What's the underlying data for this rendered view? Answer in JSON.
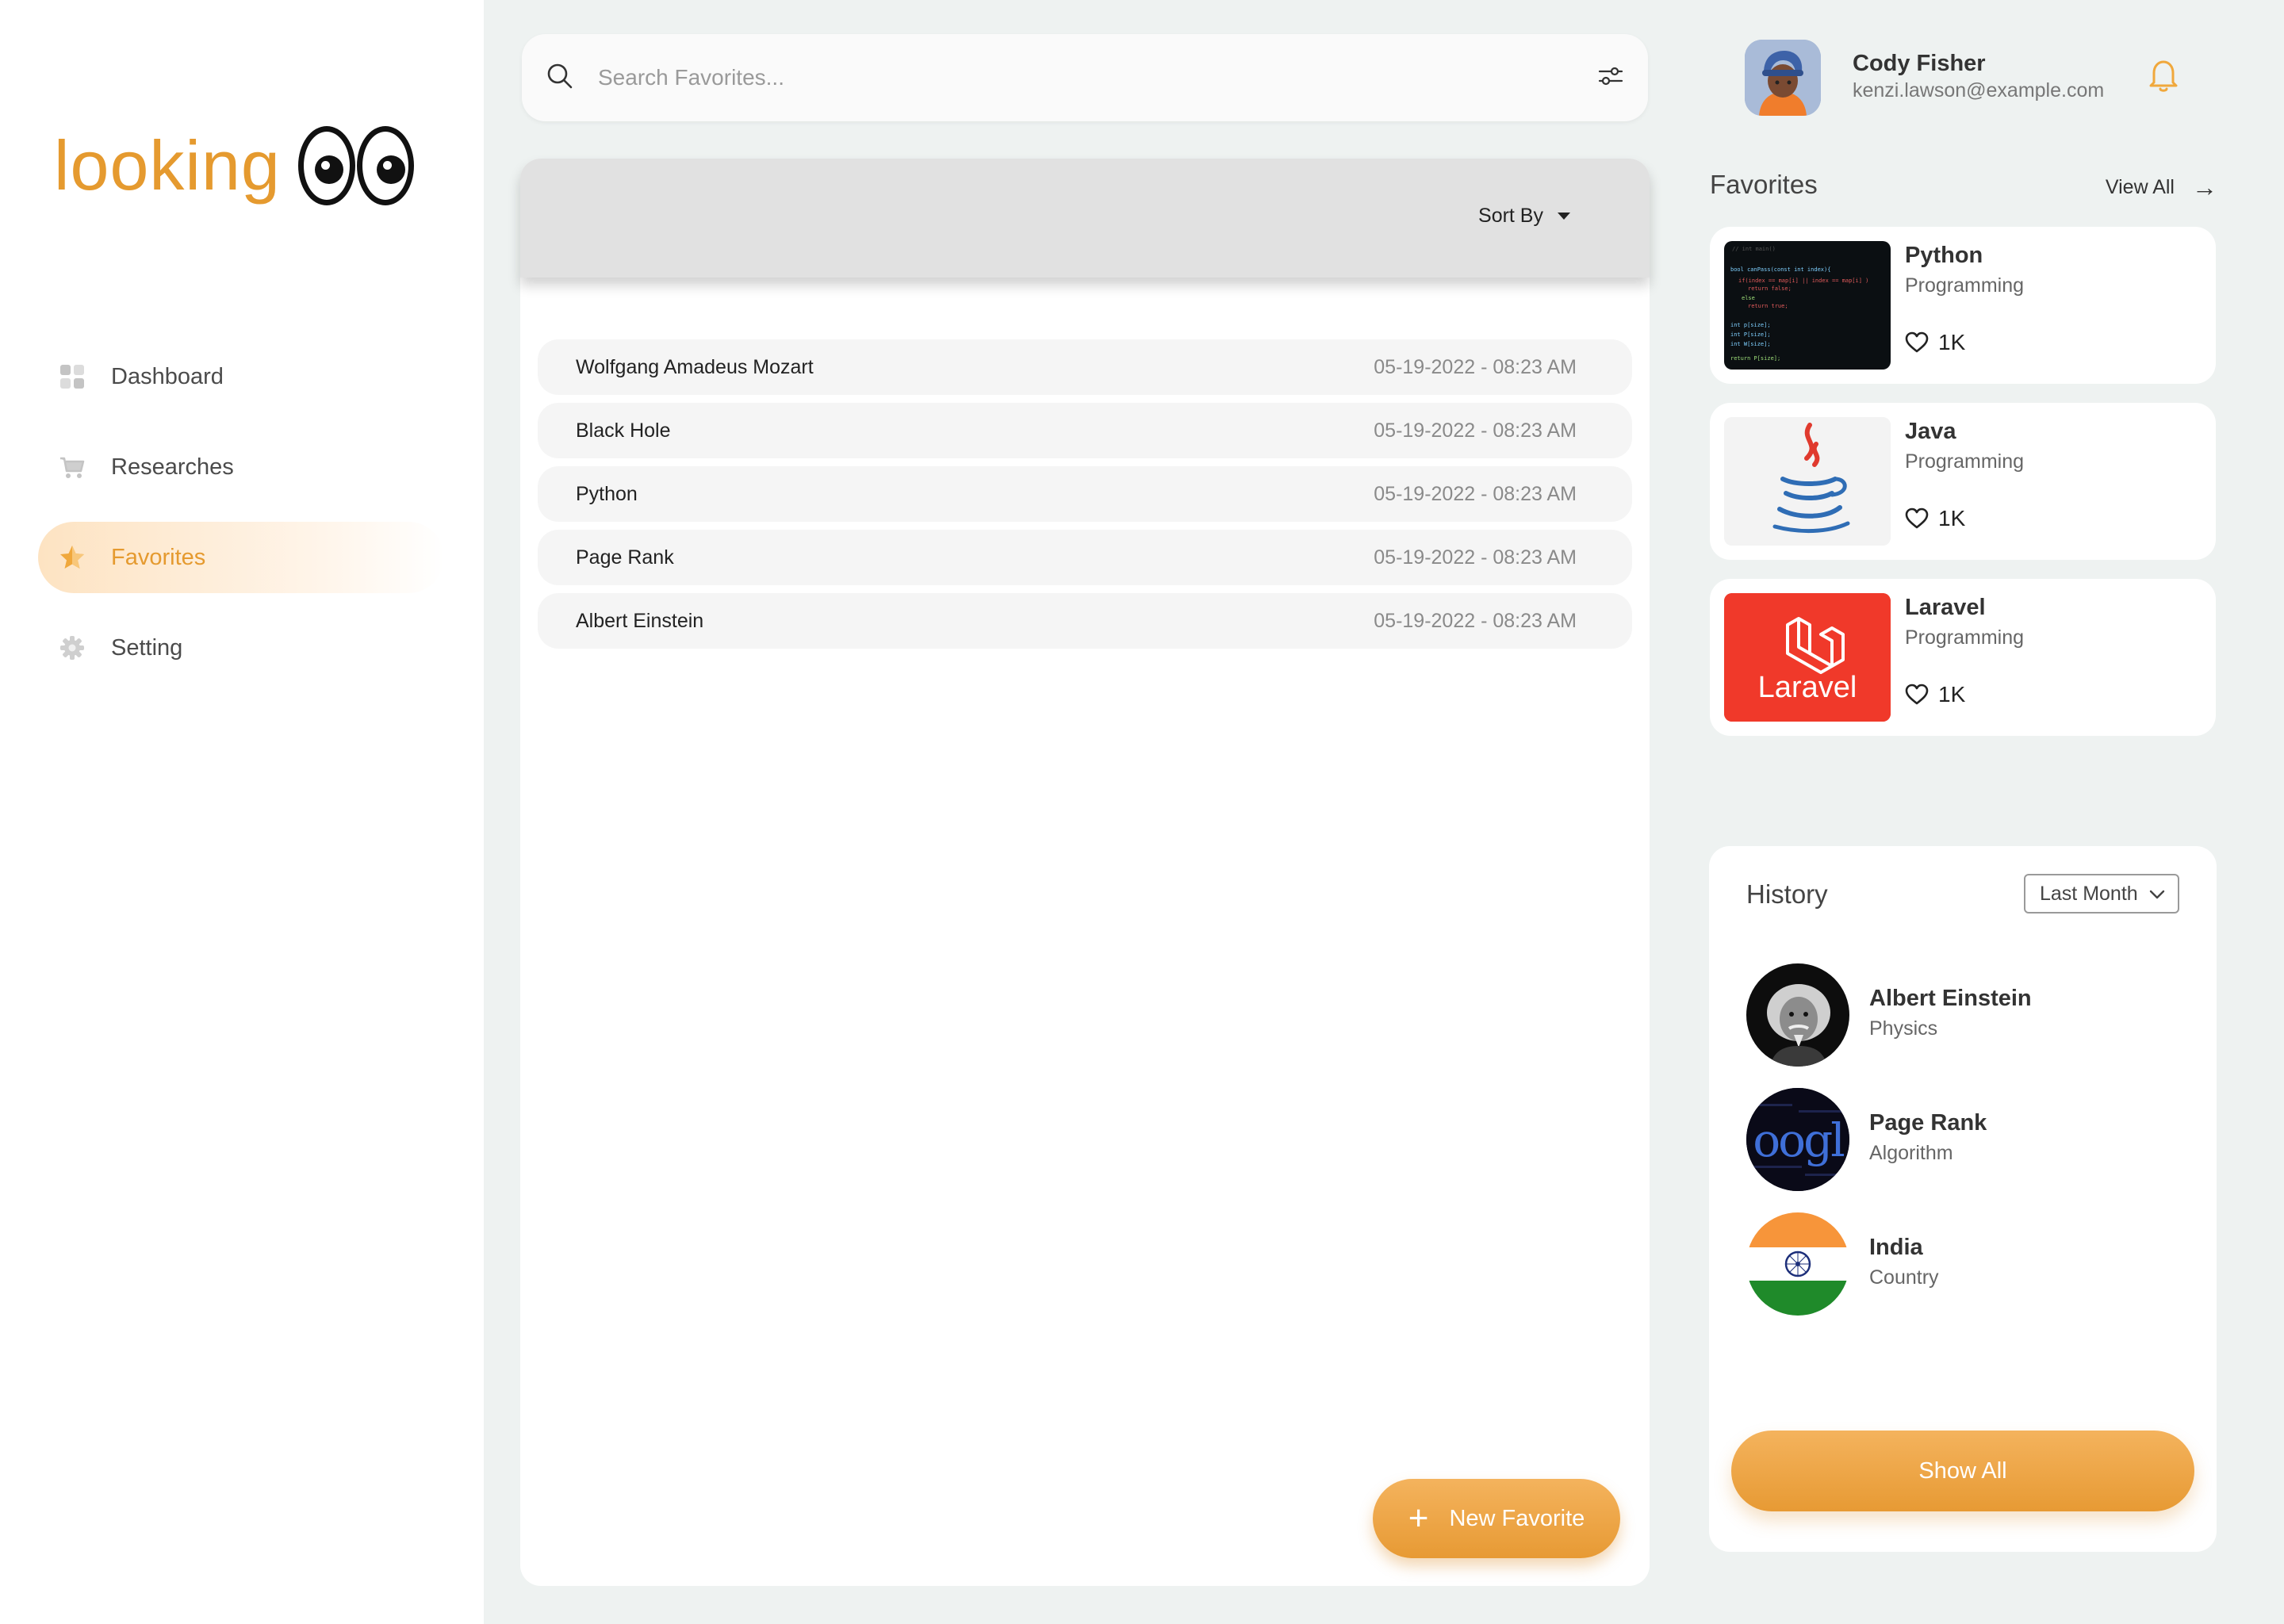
{
  "app": {
    "logo_text": "looking"
  },
  "sidebar": {
    "items": [
      {
        "label": "Dashboard",
        "icon": "dashboard-grid-icon",
        "active": false
      },
      {
        "label": "Researches",
        "icon": "cart-icon",
        "active": false
      },
      {
        "label": "Favorites",
        "icon": "star-icon",
        "active": true
      },
      {
        "label": "Setting",
        "icon": "gear-icon",
        "active": false
      }
    ]
  },
  "search": {
    "placeholder": "Search Favorites...",
    "value": ""
  },
  "main": {
    "sort_label": "Sort By",
    "favorites": [
      {
        "name": "Wolfgang Amadeus Mozart",
        "date": "05-19-2022 - 08:23 AM"
      },
      {
        "name": "Black Hole",
        "date": "05-19-2022 - 08:23 AM"
      },
      {
        "name": "Python",
        "date": "05-19-2022 - 08:23 AM"
      },
      {
        "name": "Page Rank",
        "date": "05-19-2022 - 08:23 AM"
      },
      {
        "name": "Albert Einstein",
        "date": "05-19-2022 - 08:23 AM"
      }
    ],
    "new_favorite_label": "New Favorite"
  },
  "user": {
    "name": "Cody Fisher",
    "email": "kenzi.lawson@example.com"
  },
  "favorites_panel": {
    "title": "Favorites",
    "view_all": "View All",
    "cards": [
      {
        "title": "Python",
        "category": "Programming",
        "likes": "1K"
      },
      {
        "title": "Java",
        "category": "Programming",
        "likes": "1K"
      },
      {
        "title": "Laravel",
        "category": "Programming",
        "likes": "1K"
      }
    ]
  },
  "laravel_thumb_text": "Laravel",
  "history": {
    "title": "History",
    "period": "Last Month",
    "items": [
      {
        "title": "Albert Einstein",
        "category": "Physics"
      },
      {
        "title": "Page Rank",
        "category": "Algorithm"
      },
      {
        "title": "India",
        "category": "Country"
      }
    ],
    "google_text": "oogl",
    "show_all": "Show All"
  },
  "colors": {
    "accent": "#e59a2f",
    "background": "#eef2f1",
    "panel_header": "#e1e1e1"
  }
}
